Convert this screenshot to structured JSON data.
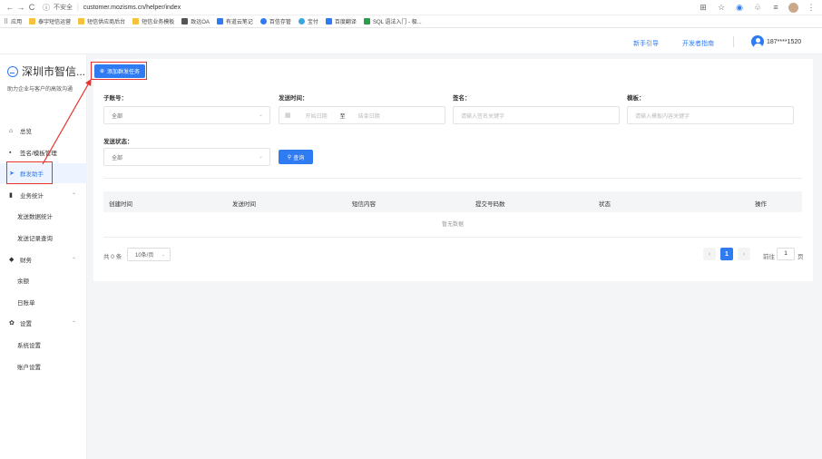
{
  "browser": {
    "insecure_label": "不安全",
    "url": "customer.mozisms.cn/helper/index",
    "bookmarks": [
      {
        "label": "应用",
        "icon": "apps-grid-icon"
      },
      {
        "label": "泰宇短信运营",
        "icon": "folder-icon"
      },
      {
        "label": "短信供应商后台",
        "icon": "folder-icon"
      },
      {
        "label": "短信业务模板",
        "icon": "folder-icon"
      },
      {
        "label": "致远OA",
        "icon": "oa-icon"
      },
      {
        "label": "有道云笔记",
        "icon": "note-icon"
      },
      {
        "label": "百信存管",
        "icon": "bank-icon"
      },
      {
        "label": "宝付",
        "icon": "pay-icon"
      },
      {
        "label": "百度翻译",
        "icon": "translate-icon"
      },
      {
        "label": "SQL 语法入门 - 极...",
        "icon": "sql-icon"
      }
    ]
  },
  "header": {
    "guide_link": "新手引导",
    "dev_link": "开发者指南",
    "user_phone": "187****1520"
  },
  "sidebar": {
    "brand_name": "深圳市智信...",
    "brand_sub": "助力企业与客户的高效沟通",
    "items": [
      {
        "label": "总览"
      },
      {
        "label": "签名/模板管理"
      },
      {
        "label": "群发助手"
      },
      {
        "label": "业务统计"
      },
      {
        "label": "发送数据统计"
      },
      {
        "label": "发送记录查询"
      },
      {
        "label": "财务"
      },
      {
        "label": "余额"
      },
      {
        "label": "日账单"
      },
      {
        "label": "设置"
      },
      {
        "label": "系统设置"
      },
      {
        "label": "账户设置"
      }
    ]
  },
  "main": {
    "add_button": "添加群发任务",
    "filters": {
      "subaccount_label": "子账号：",
      "subaccount_value": "全部",
      "sendtime_label": "发送时间：",
      "start_placeholder": "开始日期",
      "range_sep": "至",
      "end_placeholder": "结束日期",
      "sign_label": "签名：",
      "sign_placeholder": "请输入签名关键字",
      "template_label": "模板：",
      "template_placeholder": "请输入模板内容关键字",
      "status_label": "发送状态：",
      "status_value": "全部",
      "query_button": "查询"
    },
    "table": {
      "columns": [
        "创建时间",
        "发送时间",
        "短信内容",
        "提交号码数",
        "状态",
        "操作"
      ],
      "empty_text": "暂无数据"
    },
    "pagination": {
      "total": "共 0 条",
      "page_size": "10条/页",
      "current_page": "1",
      "goto_label": "前往",
      "goto_value": "1",
      "goto_unit": "页"
    }
  },
  "colors": {
    "primary": "#2f7bf2",
    "annotation_red": "#e8322e"
  }
}
